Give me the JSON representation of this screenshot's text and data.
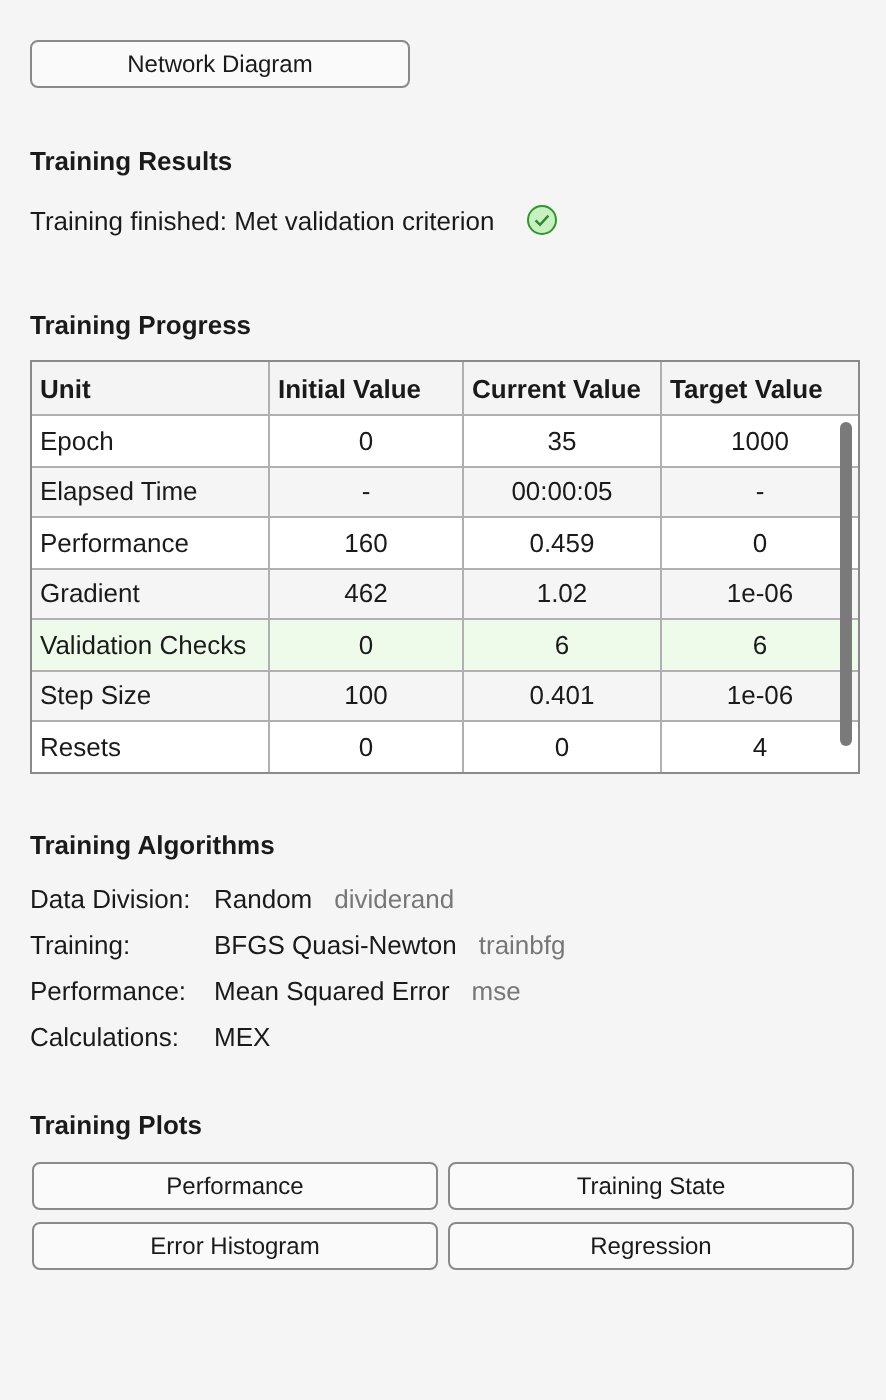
{
  "network_button": "Network Diagram",
  "results": {
    "title": "Training Results",
    "status": "Training finished: Met validation criterion",
    "success": true
  },
  "progress": {
    "title": "Training Progress",
    "columns": [
      "Unit",
      "Initial Value",
      "Current Value",
      "Target Value"
    ],
    "rows": [
      {
        "cells": [
          "Epoch",
          "0",
          "35",
          "1000"
        ],
        "highlighted": false
      },
      {
        "cells": [
          "Elapsed Time",
          "-",
          "00:00:05",
          "-"
        ],
        "highlighted": false
      },
      {
        "cells": [
          "Performance",
          "160",
          "0.459",
          "0"
        ],
        "highlighted": false
      },
      {
        "cells": [
          "Gradient",
          "462",
          "1.02",
          "1e-06"
        ],
        "highlighted": false
      },
      {
        "cells": [
          "Validation Checks",
          "0",
          "6",
          "6"
        ],
        "highlighted": true
      },
      {
        "cells": [
          "Step Size",
          "100",
          "0.401",
          "1e-06"
        ],
        "highlighted": false
      },
      {
        "cells": [
          "Resets",
          "0",
          "0",
          "4"
        ],
        "highlighted": false
      }
    ]
  },
  "algorithms": {
    "title": "Training Algorithms",
    "items": [
      {
        "label": "Data Division:",
        "value": "Random",
        "function": "dividerand"
      },
      {
        "label": "Training:",
        "value": "BFGS Quasi-Newton",
        "function": "trainbfg"
      },
      {
        "label": "Performance:",
        "value": "Mean Squared Error",
        "function": "mse"
      },
      {
        "label": "Calculations:",
        "value": "MEX"
      }
    ]
  },
  "plots": {
    "title": "Training Plots",
    "buttons": [
      "Performance",
      "Training State",
      "Error Histogram",
      "Regression"
    ]
  }
}
